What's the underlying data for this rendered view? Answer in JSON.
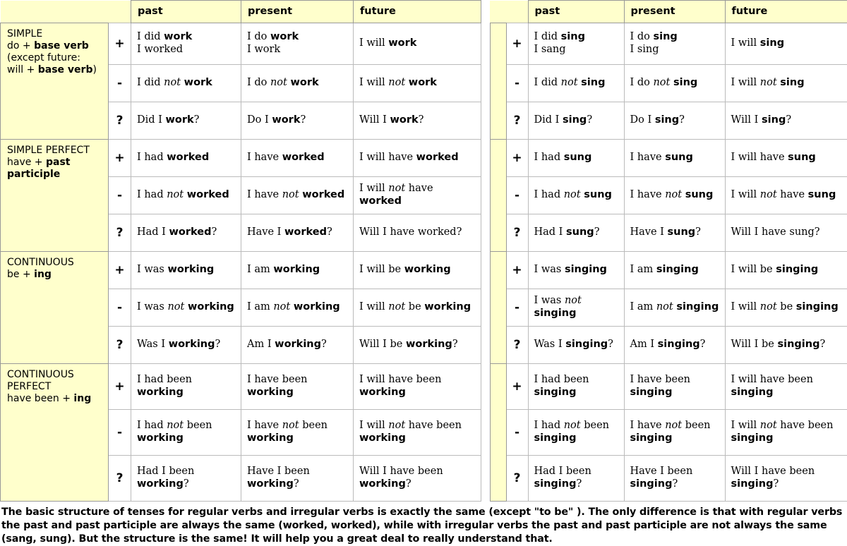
{
  "page": {
    "footer_note": "The basic structure of tenses for regular verbs and irregular verbs is exactly the same (except \"to be\" ). The only difference is that with regular verbs the past and past participle are always the same (worked, worked), while with irregular verbs the past and past participle are not always the same (sang, sung). But the structure is the same! It will help you a great deal to really understand that."
  },
  "colors": {
    "header_background": "#ffffcc",
    "label_background": "#ffffcc",
    "cell_background": "#ffffff",
    "border": "#bbbbbb",
    "header_border": "#999999",
    "text": "#000000"
  },
  "headers": {
    "past": "past",
    "present": "present",
    "future": "future",
    "blank": ""
  },
  "signs": {
    "positive": "+",
    "negative": "-",
    "question": "?"
  },
  "sections": [
    {
      "id": "simple",
      "label_lines": [
        {
          "plain": "SIMPLE"
        },
        {
          "plain": "do + ",
          "bold": "base verb"
        },
        {
          "plain": "(except future:"
        },
        {
          "plain": "will + ",
          "bold": "base verb",
          "after": ")"
        }
      ],
      "label_text": "SIMPLE do + base verb (except future: will + base verb)"
    },
    {
      "id": "simple-perfect",
      "label_lines": [
        {
          "plain": "SIMPLE PERFECT"
        },
        {
          "plain": "have + ",
          "bold": "past"
        },
        {
          "bold": "participle"
        }
      ],
      "label_text": "SIMPLE PERFECT have + past participle"
    },
    {
      "id": "continuous",
      "label_lines": [
        {
          "plain": "CONTINUOUS"
        },
        {
          "plain": "be + ",
          "bold": "ing"
        }
      ],
      "label_text": "CONTINUOUS be + ing"
    },
    {
      "id": "continuous-perfect",
      "label_lines": [
        {
          "plain": "CONTINUOUS"
        },
        {
          "plain": "PERFECT"
        },
        {
          "plain": "have been + ",
          "bold": "ing"
        }
      ],
      "label_text": "CONTINUOUS PERFECT have been + ing"
    }
  ],
  "regular_verb_table": {
    "verb": "work",
    "type": "regular",
    "rows": {
      "simple": {
        "positive": {
          "past": "I did <b>work</b><br>I worked",
          "present": "I do <b>work</b><br>I work",
          "future": "I will <b>work</b>"
        },
        "negative": {
          "past": "I did <i>not</i> <b>work</b>",
          "present": "I do <i>not</i> <b>work</b>",
          "future": "I will <i>not</i> <b>work</b>"
        },
        "question": {
          "past": "Did I <b>work</b>?",
          "present": "Do I <b>work</b>?",
          "future": "Will I <b>work</b>?"
        }
      },
      "simple-perfect": {
        "positive": {
          "past": "I had <b>worked</b>",
          "present": "I have <b>worked</b>",
          "future": "I will have <b>worked</b>"
        },
        "negative": {
          "past": "I had <i>not</i> <b>worked</b>",
          "present": "I have <i>not</i> <b>worked</b>",
          "future": "I will <i>not</i> have <b>worked</b>"
        },
        "question": {
          "past": "Had I <b>worked</b>?",
          "present": "Have I <b>worked</b>?",
          "future": "Will I have worked?"
        }
      },
      "continuous": {
        "positive": {
          "past": "I was <b>working</b>",
          "present": "I am <b>working</b>",
          "future": "I will be <b>working</b>"
        },
        "negative": {
          "past": "I was <i>not</i> <b>working</b>",
          "present": "I am <i>not</i> <b>working</b>",
          "future": "I will <i>not</i> be <b>working</b>"
        },
        "question": {
          "past": "Was I <b>working</b>?",
          "present": "Am I <b>working</b>?",
          "future": "Will I be <b>working</b>?"
        }
      },
      "continuous-perfect": {
        "positive": {
          "past": "I had been<br><b>working</b>",
          "present": "I have been<br><b>working</b>",
          "future": "I will have been<br><b>working</b>"
        },
        "negative": {
          "past": "I had <i>not</i> been<br><b>working</b>",
          "present": "I have <i>not</i> been<br><b>working</b>",
          "future": "I will <i>not</i> have been<br><b>working</b>"
        },
        "question": {
          "past": "Had I been<br><b>working</b>?",
          "present": "Have I been<br><b>working</b>?",
          "future": "Will I have been<br><b>working</b>?"
        }
      }
    }
  },
  "irregular_verb_table": {
    "verb": "sing",
    "type": "irregular",
    "rows": {
      "simple": {
        "positive": {
          "past": "I did <b>sing</b><br>I sang",
          "present": "I do <b>sing</b><br>I sing",
          "future": "I will <b>sing</b>"
        },
        "negative": {
          "past": "I did <i>not</i> <b>sing</b>",
          "present": "I do <i>not</i> <b>sing</b>",
          "future": "I will <i>not</i> <b>sing</b>"
        },
        "question": {
          "past": "Did I <b>sing</b>?",
          "present": "Do I <b>sing</b>?",
          "future": "Will I <b>sing</b>?"
        }
      },
      "simple-perfect": {
        "positive": {
          "past": "I had <b>sung</b>",
          "present": "I have <b>sung</b>",
          "future": "I will have <b>sung</b>"
        },
        "negative": {
          "past": "I had <i>not</i> <b>sung</b>",
          "present": "I have <i>not</i> <b>sung</b>",
          "future": "I will <i>not</i> have <b>sung</b>"
        },
        "question": {
          "past": "Had I <b>sung</b>?",
          "present": "Have I <b>sung</b>?",
          "future": "Will I have sung?"
        }
      },
      "continuous": {
        "positive": {
          "past": "I was <b>singing</b>",
          "present": "I am <b>singing</b>",
          "future": "I will be <b>singing</b>"
        },
        "negative": {
          "past": "I was <i>not</i> <b>singing</b>",
          "present": "I am <i>not</i> <b>singing</b>",
          "future": "I will <i>not</i> be <b>singing</b>"
        },
        "question": {
          "past": "Was I <b>singing</b>?",
          "present": "Am I <b>singing</b>?",
          "future": "Will I be <b>singing</b>?"
        }
      },
      "continuous-perfect": {
        "positive": {
          "past": "I had been<br><b>singing</b>",
          "present": "I have been<br><b>singing</b>",
          "future": "I will have been<br><b>singing</b>"
        },
        "negative": {
          "past": "I had <i>not</i> been<br><b>singing</b>",
          "present": "I have <i>not</i> been<br><b>singing</b>",
          "future": "I will <i>not</i> have been<br><b>singing</b>"
        },
        "question": {
          "past": "Had I been<br><b>singing</b>?",
          "present": "Have I been<br><b>singing</b>?",
          "future": "Will I have been<br><b>singing</b>?"
        }
      }
    }
  }
}
